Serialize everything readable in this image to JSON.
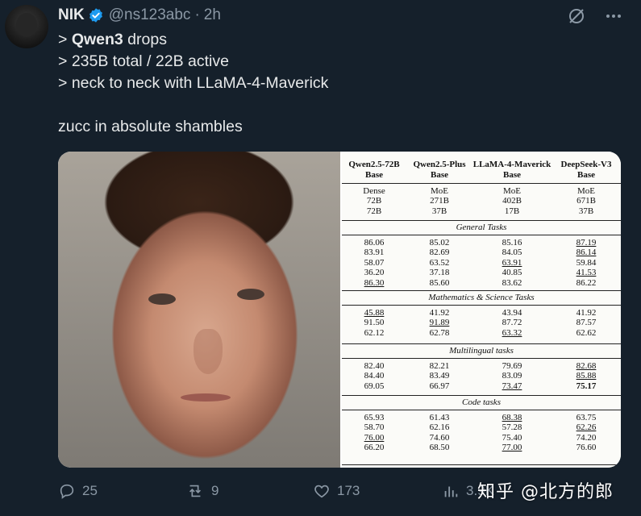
{
  "tweet": {
    "author_name": "NIK",
    "handle": "@ns123abc",
    "separator": "·",
    "time": "2h",
    "lines": [
      {
        "prefix": "> ",
        "bold": "Qwen3",
        "rest": " drops"
      },
      {
        "prefix": "> ",
        "bold": "",
        "rest": "235B total / 22B active"
      },
      {
        "prefix": "> ",
        "bold": "",
        "rest": "neck to neck with LLaMA-4-Maverick"
      }
    ],
    "closing_line": "zucc in absolute shambles"
  },
  "table": {
    "columns": [
      {
        "name": "Qwen2.5-72B",
        "sub": "Base"
      },
      {
        "name": "Qwen2.5-Plus",
        "sub": "Base"
      },
      {
        "name": "LLaMA-4-Maverick",
        "sub": "Base"
      },
      {
        "name": "DeepSeek-V3",
        "sub": "Base"
      }
    ],
    "arch_rows": [
      [
        "Dense",
        "MoE",
        "MoE",
        "MoE"
      ],
      [
        "72B",
        "271B",
        "402B",
        "671B"
      ],
      [
        "72B",
        "37B",
        "17B",
        "37B"
      ]
    ],
    "sections": [
      {
        "title": "General Tasks",
        "rows": [
          [
            "86.06",
            "85.02",
            "85.16",
            "87.19"
          ],
          [
            "83.91",
            "82.69",
            "84.05",
            "86.14"
          ],
          [
            "58.07",
            "63.52",
            "63.91",
            "59.84"
          ],
          [
            "36.20",
            "37.18",
            "40.85",
            "41.53"
          ],
          [
            "86.30",
            "85.60",
            "83.62",
            "86.22"
          ]
        ]
      },
      {
        "title": "Mathematics & Science Tasks",
        "rows": [
          [
            "45.88",
            "41.92",
            "43.94",
            "41.92"
          ],
          [
            "91.50",
            "91.89",
            "87.72",
            "87.57"
          ],
          [
            "62.12",
            "62.78",
            "63.32",
            "62.62"
          ]
        ]
      },
      {
        "title": "Multilingual tasks",
        "rows": [
          [
            "82.40",
            "82.21",
            "79.69",
            "82.68"
          ],
          [
            "84.40",
            "83.49",
            "83.09",
            "85.88"
          ],
          [
            "69.05",
            "66.97",
            "73.47",
            "75.17"
          ]
        ]
      },
      {
        "title": "Code tasks",
        "rows": [
          [
            "65.93",
            "61.43",
            "68.38",
            "63.75"
          ],
          [
            "58.70",
            "62.16",
            "57.28",
            "62.26"
          ],
          [
            "76.00",
            "74.60",
            "75.40",
            "74.20"
          ],
          [
            "66.20",
            "68.50",
            "77.00",
            "76.60"
          ]
        ]
      }
    ]
  },
  "actions": {
    "replies": "25",
    "reposts": "9",
    "likes": "173",
    "views": "3.9K"
  },
  "watermark": "知乎 @北方的郎",
  "colors": {
    "background": "#15202b",
    "text": "#e7e9ea",
    "muted": "#8b98a5",
    "verified": "#1d9bf0"
  }
}
